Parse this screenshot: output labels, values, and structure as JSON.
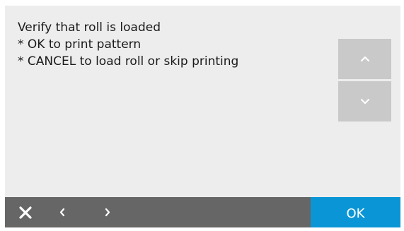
{
  "message": {
    "lines": [
      "Verify that roll is loaded",
      "* OK to print pattern",
      "* CANCEL to load roll or skip printing"
    ]
  },
  "scroll": {
    "up_icon": "chevron-up-icon",
    "down_icon": "chevron-down-icon"
  },
  "footer": {
    "close_icon": "close-icon",
    "back_icon": "chevron-left-icon",
    "forward_icon": "chevron-right-icon",
    "ok_label": "OK"
  },
  "colors": {
    "screen_background": "#ededed",
    "scroll_button": "#c9c9c9",
    "footer_bar": "#666666",
    "ok_button": "#0a96d6"
  }
}
